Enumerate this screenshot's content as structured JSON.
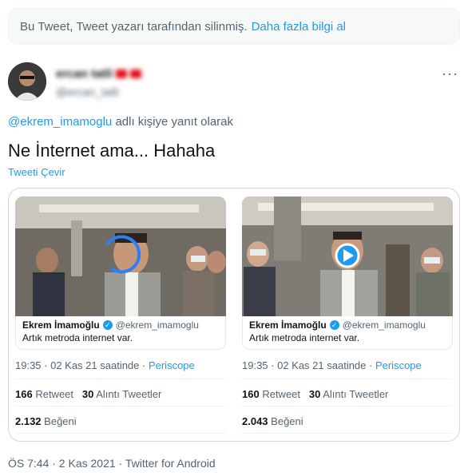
{
  "notice": {
    "text": "Bu Tweet, Tweet yazarı tarafından silinmiş.",
    "link": "Daha fazla bilgi al"
  },
  "author": {
    "display_name": "ercan tatli",
    "handle": "@ercan_tatli"
  },
  "more_icon": "more-horizontal-icon",
  "reply": {
    "mention": "@ekrem_imamoglu",
    "suffix": "adlı kişiye yanıt olarak"
  },
  "tweet": {
    "text": "Ne İnternet ama... Hahaha",
    "translate": "Tweeti Çevir"
  },
  "screenshots": [
    {
      "quote_name": "Ekrem İmamoğlu",
      "quote_handle": "@ekrem_imamoglu",
      "quote_text": "Artık metroda internet var.",
      "time": "19:35 · 02 Kas 21 saatinde · ",
      "source": "Periscope",
      "retweets": "166",
      "retweets_label": "Retweet",
      "quotes": "30",
      "quotes_label": "Alıntı Tweetler",
      "likes": "2.132",
      "likes_label": "Beğeni"
    },
    {
      "quote_name": "Ekrem İmamoğlu",
      "quote_handle": "@ekrem_imamoglu",
      "quote_text": "Artık metroda internet var.",
      "time": "19:35 · 02 Kas 21 saatinde · ",
      "source": "Periscope",
      "retweets": "160",
      "retweets_label": "Retweet",
      "quotes": "30",
      "quotes_label": "Alıntı Tweetler",
      "likes": "2.043",
      "likes_label": "Beğeni"
    }
  ],
  "footer": "ÖS 7:44 · 2 Kas 2021 · Twitter for Android",
  "colors": {
    "accent": "#1d9bf0",
    "secondary_text": "#536471",
    "border": "#cfd9de"
  }
}
